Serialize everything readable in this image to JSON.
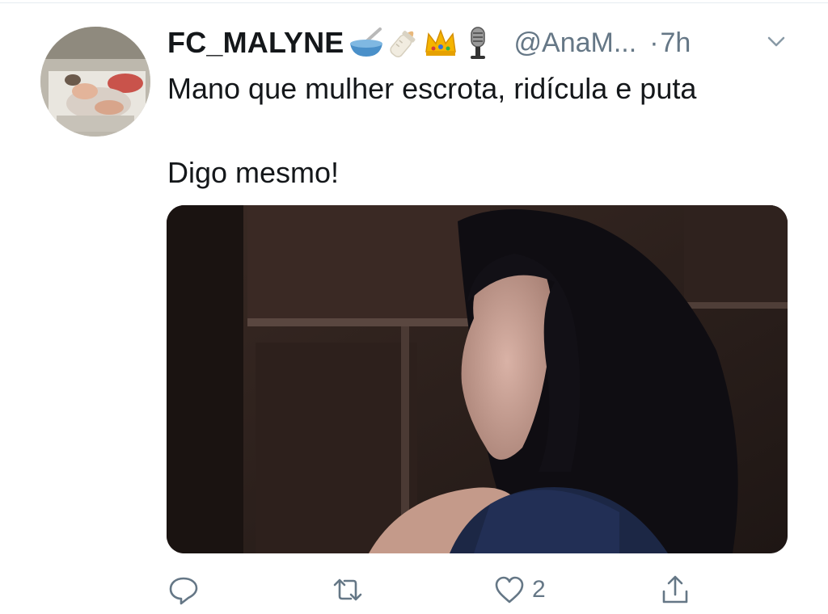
{
  "tweet": {
    "display_name": "FC_MALYNE",
    "name_emojis": [
      "bowl-with-spoon-emoji",
      "baby-bottle-emoji",
      "crown-emoji",
      "microphone-emoji"
    ],
    "handle": "@AnaM...",
    "separator": "·",
    "time": "7h",
    "text_line1": "Mano que mulher escrota, ridícula e puta",
    "text_line2": "Digo mesmo!",
    "like_count": "2"
  },
  "icons": {
    "reply": "reply-icon",
    "retweet": "retweet-icon",
    "like": "heart-icon",
    "share": "share-icon",
    "more": "chevron-down-icon"
  },
  "colors": {
    "text": "#14171a",
    "secondary": "#657786",
    "divider": "#e6ecf0"
  }
}
